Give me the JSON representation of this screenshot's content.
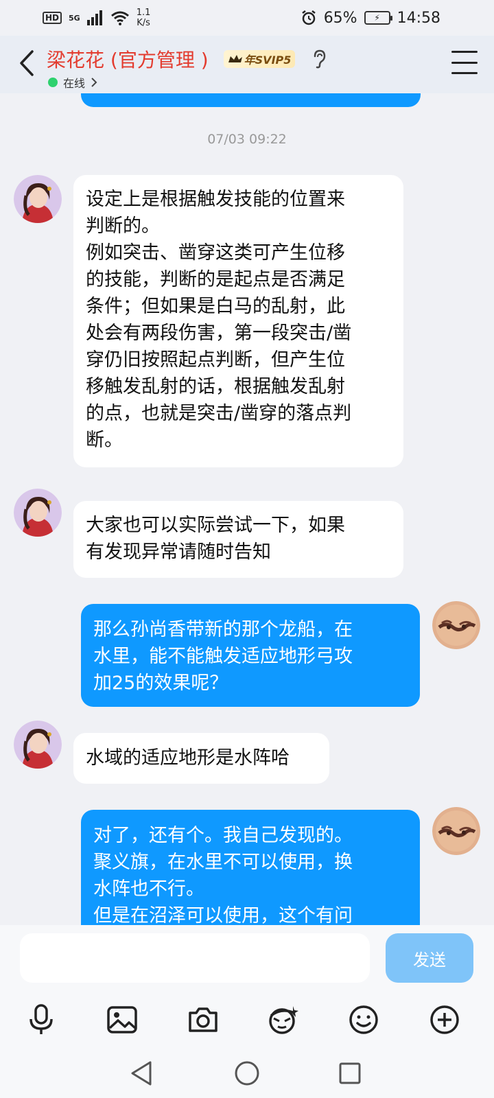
{
  "status_bar": {
    "hd_label": "HD",
    "network_label": "5G",
    "net_speed_value": "1.1",
    "net_speed_unit": "K/s",
    "battery_percent": "65%",
    "time": "14:58"
  },
  "header": {
    "contact_name": "梁花花 (官方管理 )",
    "vip_label": "年SVIP5",
    "status_text": "在线",
    "icons": [
      "back-arrow-icon",
      "crown-icon",
      "ear-icon",
      "menu-icon"
    ]
  },
  "chat": {
    "timestamp": "07/03 09:22",
    "messages": [
      {
        "direction": "in",
        "text": "设定上是根据触发技能的位置来\n判断的。\n例如突击、凿穿这类可产生位移\n的技能，判断的是起点是否满足\n条件；但如果是白马的乱射，此\n处会有两段伤害，第一段突击/凿\n穿仍旧按照起点判断，但产生位\n移触发乱射的话，根据触发乱射\n的点，也就是突击/凿穿的落点判\n断。"
      },
      {
        "direction": "in",
        "text": "大家也可以实际尝试一下，如果\n有发现异常请随时告知"
      },
      {
        "direction": "out",
        "text": "那么孙尚香带新的那个龙船，在\n水里，能不能触发适应地形弓攻\n加25的效果呢？"
      },
      {
        "direction": "in",
        "text": "水域的适应地形是水阵哈"
      },
      {
        "direction": "out",
        "text": "对了，还有个。我自己发现的。\n聚义旗，在水里不可以使用，换\n水阵也不行。\n但是在沼泽可以使用，这个有问"
      }
    ]
  },
  "composer": {
    "input_value": "",
    "send_label": "发送",
    "tools": [
      "microphone-icon",
      "image-icon",
      "camera-icon",
      "sticker-icon",
      "emoji-icon",
      "plus-icon"
    ]
  },
  "colors": {
    "name_red": "#e33b2e",
    "outgoing_bubble": "#0f99ff",
    "incoming_bubble": "#ffffff",
    "send_button": "#7fc4f9",
    "online_green": "#2ed16e"
  }
}
